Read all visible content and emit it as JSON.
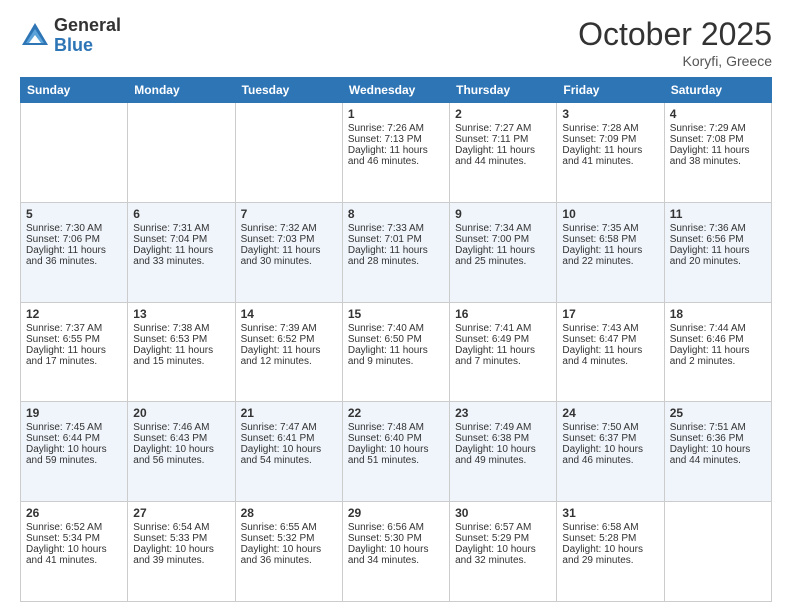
{
  "header": {
    "logo_general": "General",
    "logo_blue": "Blue",
    "month_title": "October 2025",
    "location": "Koryfi, Greece"
  },
  "days_of_week": [
    "Sunday",
    "Monday",
    "Tuesday",
    "Wednesday",
    "Thursday",
    "Friday",
    "Saturday"
  ],
  "weeks": [
    [
      {
        "day": "",
        "sunrise": "",
        "sunset": "",
        "daylight": ""
      },
      {
        "day": "",
        "sunrise": "",
        "sunset": "",
        "daylight": ""
      },
      {
        "day": "",
        "sunrise": "",
        "sunset": "",
        "daylight": ""
      },
      {
        "day": "1",
        "sunrise": "Sunrise: 7:26 AM",
        "sunset": "Sunset: 7:13 PM",
        "daylight": "Daylight: 11 hours and 46 minutes."
      },
      {
        "day": "2",
        "sunrise": "Sunrise: 7:27 AM",
        "sunset": "Sunset: 7:11 PM",
        "daylight": "Daylight: 11 hours and 44 minutes."
      },
      {
        "day": "3",
        "sunrise": "Sunrise: 7:28 AM",
        "sunset": "Sunset: 7:09 PM",
        "daylight": "Daylight: 11 hours and 41 minutes."
      },
      {
        "day": "4",
        "sunrise": "Sunrise: 7:29 AM",
        "sunset": "Sunset: 7:08 PM",
        "daylight": "Daylight: 11 hours and 38 minutes."
      }
    ],
    [
      {
        "day": "5",
        "sunrise": "Sunrise: 7:30 AM",
        "sunset": "Sunset: 7:06 PM",
        "daylight": "Daylight: 11 hours and 36 minutes."
      },
      {
        "day": "6",
        "sunrise": "Sunrise: 7:31 AM",
        "sunset": "Sunset: 7:04 PM",
        "daylight": "Daylight: 11 hours and 33 minutes."
      },
      {
        "day": "7",
        "sunrise": "Sunrise: 7:32 AM",
        "sunset": "Sunset: 7:03 PM",
        "daylight": "Daylight: 11 hours and 30 minutes."
      },
      {
        "day": "8",
        "sunrise": "Sunrise: 7:33 AM",
        "sunset": "Sunset: 7:01 PM",
        "daylight": "Daylight: 11 hours and 28 minutes."
      },
      {
        "day": "9",
        "sunrise": "Sunrise: 7:34 AM",
        "sunset": "Sunset: 7:00 PM",
        "daylight": "Daylight: 11 hours and 25 minutes."
      },
      {
        "day": "10",
        "sunrise": "Sunrise: 7:35 AM",
        "sunset": "Sunset: 6:58 PM",
        "daylight": "Daylight: 11 hours and 22 minutes."
      },
      {
        "day": "11",
        "sunrise": "Sunrise: 7:36 AM",
        "sunset": "Sunset: 6:56 PM",
        "daylight": "Daylight: 11 hours and 20 minutes."
      }
    ],
    [
      {
        "day": "12",
        "sunrise": "Sunrise: 7:37 AM",
        "sunset": "Sunset: 6:55 PM",
        "daylight": "Daylight: 11 hours and 17 minutes."
      },
      {
        "day": "13",
        "sunrise": "Sunrise: 7:38 AM",
        "sunset": "Sunset: 6:53 PM",
        "daylight": "Daylight: 11 hours and 15 minutes."
      },
      {
        "day": "14",
        "sunrise": "Sunrise: 7:39 AM",
        "sunset": "Sunset: 6:52 PM",
        "daylight": "Daylight: 11 hours and 12 minutes."
      },
      {
        "day": "15",
        "sunrise": "Sunrise: 7:40 AM",
        "sunset": "Sunset: 6:50 PM",
        "daylight": "Daylight: 11 hours and 9 minutes."
      },
      {
        "day": "16",
        "sunrise": "Sunrise: 7:41 AM",
        "sunset": "Sunset: 6:49 PM",
        "daylight": "Daylight: 11 hours and 7 minutes."
      },
      {
        "day": "17",
        "sunrise": "Sunrise: 7:43 AM",
        "sunset": "Sunset: 6:47 PM",
        "daylight": "Daylight: 11 hours and 4 minutes."
      },
      {
        "day": "18",
        "sunrise": "Sunrise: 7:44 AM",
        "sunset": "Sunset: 6:46 PM",
        "daylight": "Daylight: 11 hours and 2 minutes."
      }
    ],
    [
      {
        "day": "19",
        "sunrise": "Sunrise: 7:45 AM",
        "sunset": "Sunset: 6:44 PM",
        "daylight": "Daylight: 10 hours and 59 minutes."
      },
      {
        "day": "20",
        "sunrise": "Sunrise: 7:46 AM",
        "sunset": "Sunset: 6:43 PM",
        "daylight": "Daylight: 10 hours and 56 minutes."
      },
      {
        "day": "21",
        "sunrise": "Sunrise: 7:47 AM",
        "sunset": "Sunset: 6:41 PM",
        "daylight": "Daylight: 10 hours and 54 minutes."
      },
      {
        "day": "22",
        "sunrise": "Sunrise: 7:48 AM",
        "sunset": "Sunset: 6:40 PM",
        "daylight": "Daylight: 10 hours and 51 minutes."
      },
      {
        "day": "23",
        "sunrise": "Sunrise: 7:49 AM",
        "sunset": "Sunset: 6:38 PM",
        "daylight": "Daylight: 10 hours and 49 minutes."
      },
      {
        "day": "24",
        "sunrise": "Sunrise: 7:50 AM",
        "sunset": "Sunset: 6:37 PM",
        "daylight": "Daylight: 10 hours and 46 minutes."
      },
      {
        "day": "25",
        "sunrise": "Sunrise: 7:51 AM",
        "sunset": "Sunset: 6:36 PM",
        "daylight": "Daylight: 10 hours and 44 minutes."
      }
    ],
    [
      {
        "day": "26",
        "sunrise": "Sunrise: 6:52 AM",
        "sunset": "Sunset: 5:34 PM",
        "daylight": "Daylight: 10 hours and 41 minutes."
      },
      {
        "day": "27",
        "sunrise": "Sunrise: 6:54 AM",
        "sunset": "Sunset: 5:33 PM",
        "daylight": "Daylight: 10 hours and 39 minutes."
      },
      {
        "day": "28",
        "sunrise": "Sunrise: 6:55 AM",
        "sunset": "Sunset: 5:32 PM",
        "daylight": "Daylight: 10 hours and 36 minutes."
      },
      {
        "day": "29",
        "sunrise": "Sunrise: 6:56 AM",
        "sunset": "Sunset: 5:30 PM",
        "daylight": "Daylight: 10 hours and 34 minutes."
      },
      {
        "day": "30",
        "sunrise": "Sunrise: 6:57 AM",
        "sunset": "Sunset: 5:29 PM",
        "daylight": "Daylight: 10 hours and 32 minutes."
      },
      {
        "day": "31",
        "sunrise": "Sunrise: 6:58 AM",
        "sunset": "Sunset: 5:28 PM",
        "daylight": "Daylight: 10 hours and 29 minutes."
      },
      {
        "day": "",
        "sunrise": "",
        "sunset": "",
        "daylight": ""
      }
    ]
  ]
}
